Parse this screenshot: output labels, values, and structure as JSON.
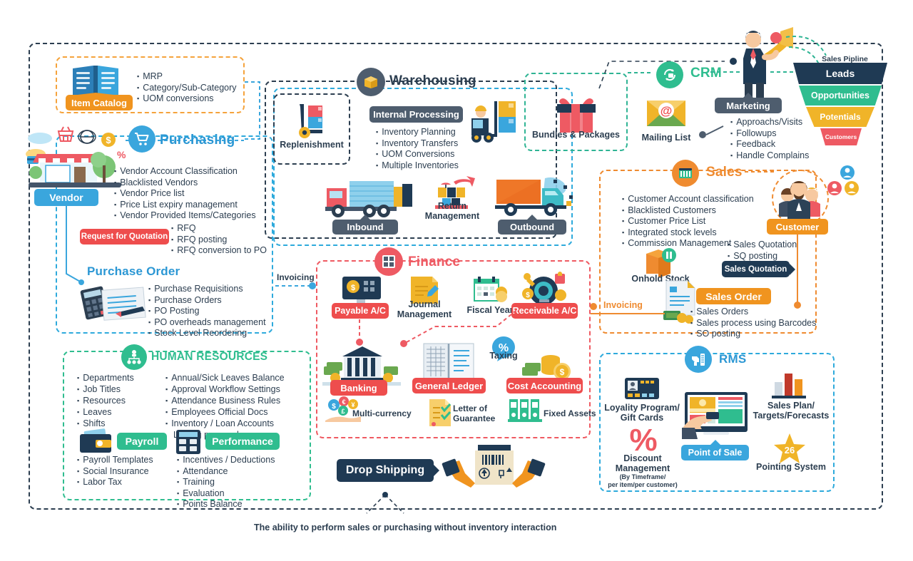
{
  "sections": {
    "item_catalog": {
      "label": "Item Catalog",
      "bullets": [
        "MRP",
        "Category/Sub-Category",
        "UOM conversions"
      ]
    },
    "purchasing": {
      "title": "Purchasing",
      "vendor_label": "Vendor",
      "bullets": [
        "Vendor Account Classification",
        "Blacklisted Vendors",
        "Vendor Price list",
        "Price List expiry management",
        "Vendor Provided Items/Categories"
      ],
      "rfq_label": "Request for Quotation",
      "rfq_bullets": [
        "RFQ",
        "RFQ posting",
        "RFQ conversion to PO"
      ],
      "po_title": "Purchase Order",
      "po_bullets": [
        "Purchase Requisitions",
        "Purchase Orders",
        "PO Posting",
        "PO overheads management",
        "Stock Level Reordering"
      ]
    },
    "warehousing": {
      "title": "Warehousing",
      "replenishment_label": "Replenishment",
      "internal_processing_label": "Internal Processing",
      "internal_bullets": [
        "Inventory Planning",
        "Inventory Transfers",
        "UOM Conversions",
        "Multiple Inventories"
      ],
      "inbound_label": "Inbound",
      "return_label_1": "Return",
      "return_label_2": "Management",
      "outbound_label": "Outbound",
      "bundles_label": "Bundles & Packages"
    },
    "crm": {
      "title": "CRM",
      "mailing_list_label": "Mailing List",
      "marketing_label": "Marketing",
      "marketing_bullets": [
        "Approachs/Visits",
        "Followups",
        "Feedback",
        "Handle Complains"
      ],
      "pipeline_title": "Sales Pipline",
      "pipeline_stages": [
        "Leads",
        "Opportunities",
        "Potentials",
        "Customers"
      ]
    },
    "sales": {
      "title": "Sales",
      "bullets": [
        "Customer Account classification",
        "Blacklisted Customers",
        "Customer Price List",
        "Integrated stock levels",
        "Commission Management"
      ],
      "customer_label": "Customer",
      "onhold_stock_label": "Onhold Stock",
      "quotation_bullets": [
        "Sales Quotation",
        "SQ posting"
      ],
      "sales_quotation_label": "Sales Quotation",
      "sales_order_label": "Sales Order",
      "order_bullets": [
        "Sales Orders",
        "Sales process using Barcodes",
        "SO posting"
      ],
      "invoicing_label": "Invoicing"
    },
    "finance": {
      "title": "Finance",
      "invoicing_label": "Invoicing",
      "payable_label": "Payable A/C",
      "journal_label_1": "Journal",
      "journal_label_2": "Management",
      "fiscal_year_label": "Fiscal Year",
      "receivable_label": "Receivable A/C",
      "banking_label": "Banking",
      "general_ledger_label": "General Ledger",
      "taxing_label": "Taxing",
      "cost_accounting_label": "Cost Accounting",
      "multicurrency_label": "Multi-currency",
      "letter_label_1": "Letter of",
      "letter_label_2": "Guarantee",
      "fixed_assets_label": "Fixed Assets"
    },
    "hr": {
      "title": "HUMAN RESOURCES",
      "bullets_left": [
        "Departments",
        "Job Titles",
        "Resources",
        "Leaves",
        "Shifts"
      ],
      "bullets_right": [
        "Annual/Sick Leaves Balance",
        "Approval Workflow Settings",
        "Attendance Business Rules",
        "Employees Official Docs",
        "Inventory / Loan Accounts",
        "Linking per employee"
      ],
      "payroll_label": "Payroll",
      "payroll_bullets": [
        "Payroll Templates",
        "Social Insurance",
        "Labor Tax"
      ],
      "performance_label": "Performance",
      "performance_bullets": [
        "Incentives / Deductions",
        "Attendance",
        "Training",
        "Evaluation",
        "Points Balance"
      ]
    },
    "rms": {
      "title": "RMS",
      "loyalty_label_1": "Loyality Program/",
      "loyalty_label_2": "Gift Cards",
      "pos_label": "Point of Sale",
      "sales_plan_label_1": "Sales Plan/",
      "sales_plan_label_2": "Targets/Forecasts",
      "discount_label_1": "Discount",
      "discount_label_2": "Management",
      "discount_sub_1": "(By Timeframe/",
      "discount_sub_2": "per item/per customer)",
      "pointing_label": "Pointing System",
      "pointing_value": "26"
    },
    "dropshipping": {
      "label": "Drop Shipping"
    }
  },
  "footer_note": "The ability to perform sales or purchasing without inventory interaction",
  "colors": {
    "blue": "#2b97d4",
    "orange": "#ef8b30",
    "teal": "#2ca89a",
    "green": "#2fbd8f",
    "red": "#ee5a63",
    "navy": "#2c3e50",
    "darknavy": "#1f3a54"
  }
}
